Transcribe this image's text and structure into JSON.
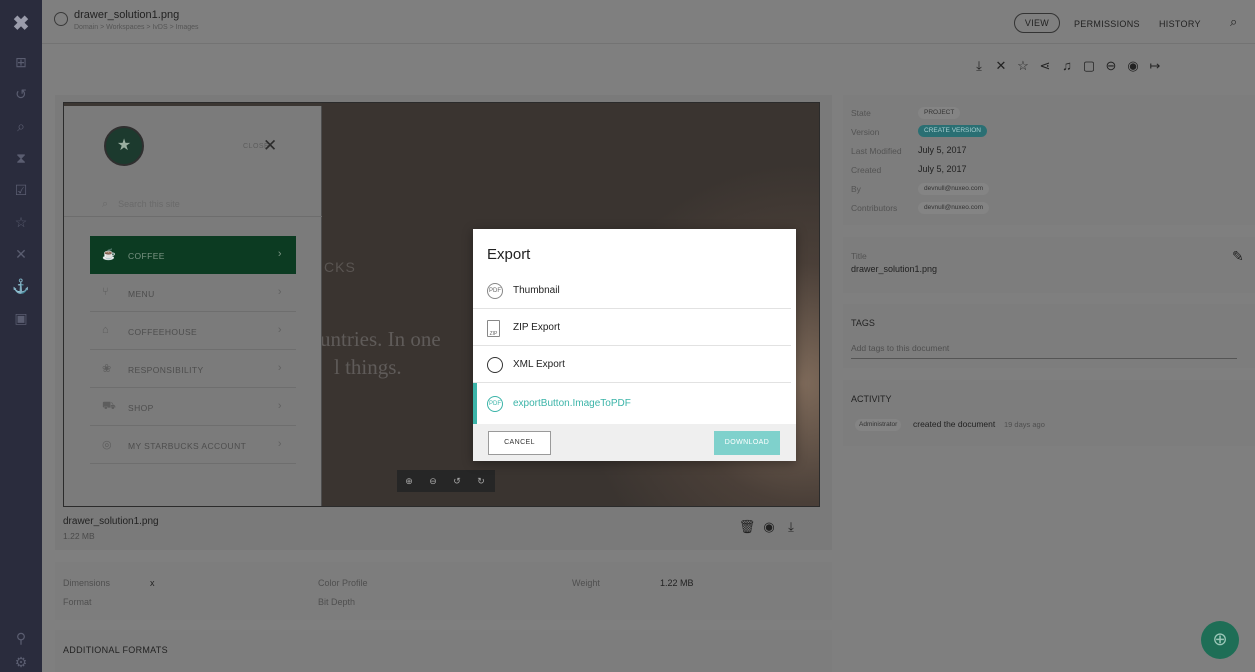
{
  "rail": {
    "icons": [
      "close-icon",
      "sitemap-icon",
      "history-icon",
      "search-icon",
      "hourglass-icon",
      "tasks-icon",
      "star-icon",
      "compare-icon",
      "anchor-icon",
      "clipboard-icon",
      "org-chart-icon",
      "settings-icon"
    ]
  },
  "header": {
    "title": "drawer_solution1.png",
    "breadcrumb": "Domain > Workspaces > IvDS > Images",
    "view_label": "VIEW",
    "permissions_label": "PERMISSIONS",
    "history_label": "HISTORY"
  },
  "toolbar": {
    "icons": [
      "download-icon",
      "compare-icon",
      "star-icon",
      "share-icon",
      "bell-icon",
      "clipboard-icon",
      "lock-icon",
      "eye-icon",
      "export-icon"
    ]
  },
  "preview": {
    "close_text": "CLOSE",
    "search_placeholder": "Search this site",
    "menu": [
      {
        "label": "COFFEE",
        "active": true
      },
      {
        "label": "MENU",
        "active": false
      },
      {
        "label": "COFFEEHOUSE",
        "active": false
      },
      {
        "label": "RESPONSIBILITY",
        "active": false
      },
      {
        "label": "SHOP",
        "active": false
      },
      {
        "label": "MY STARBUCKS ACCOUNT",
        "active": false
      }
    ],
    "bg_brand": "CKS",
    "bg_line1": "untries. In one",
    "bg_line2": "l things."
  },
  "file": {
    "name": "drawer_solution1.png",
    "size": "1.22 MB"
  },
  "info": {
    "dimensions_label": "Dimensions",
    "dimensions_value": "x",
    "format_label": "Format",
    "color_profile_label": "Color Profile",
    "bit_depth_label": "Bit Depth",
    "weight_label": "Weight",
    "weight_value": "1.22 MB"
  },
  "additional_formats_label": "ADDITIONAL FORMATS",
  "metadata": {
    "state_label": "State",
    "state_value": "PROJECT",
    "version_label": "Version",
    "version_value": "CREATE VERSION",
    "last_modified_label": "Last Modified",
    "last_modified_value": "July 5, 2017",
    "created_label": "Created",
    "created_value": "July 5, 2017",
    "by_label": "By",
    "by_value": "devnull@nuxeo.com",
    "contributors_label": "Contributors",
    "contributors_value": "devnull@nuxeo.com"
  },
  "title_panel": {
    "label": "Title",
    "value": "drawer_solution1.png"
  },
  "tags": {
    "label": "TAGS",
    "placeholder": "Add tags to this document"
  },
  "activity": {
    "label": "ACTIVITY",
    "user": "Administrator",
    "action": "created the document",
    "time": "19 days ago"
  },
  "modal": {
    "title": "Export",
    "options": [
      {
        "label": "Thumbnail",
        "icon": "pdf-icon",
        "selected": false
      },
      {
        "label": "ZIP Export",
        "icon": "zip-icon",
        "selected": false
      },
      {
        "label": "XML Export",
        "icon": "xml-icon",
        "selected": false
      },
      {
        "label": "exportButton.ImageToPDF",
        "icon": "pdf-icon",
        "selected": true
      }
    ],
    "cancel_label": "CANCEL",
    "download_label": "DOWNLOAD"
  },
  "colors": {
    "accent": "#3bb4a8",
    "rail": "#2a2c3d",
    "overlay": "#7f7f7f"
  }
}
